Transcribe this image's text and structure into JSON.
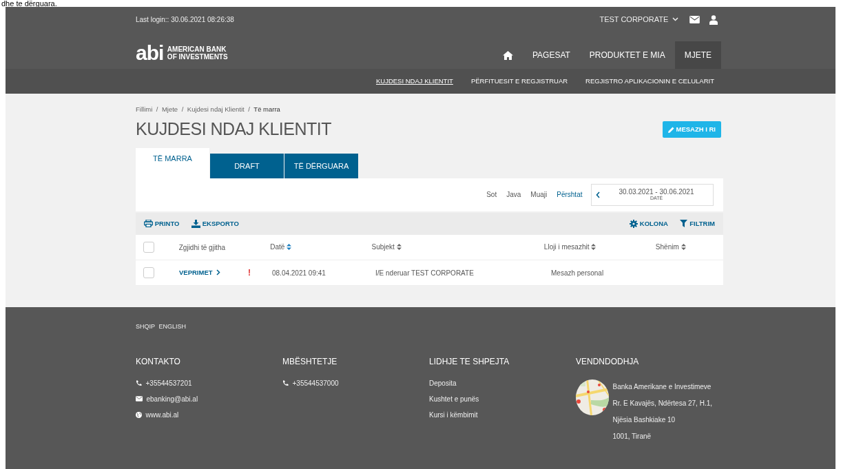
{
  "doc_fragment": "dhe te dërguara.",
  "top_bar": {
    "last_login": "Last login:: 30.06.2021 08:26:38",
    "company": "TEST CORPORATE"
  },
  "brand": {
    "logo": "abi",
    "name_line1": "AMERICAN BANK",
    "name_line2": "OF INVESTMENTS"
  },
  "main_nav": [
    {
      "kind": "home",
      "selected": false
    },
    {
      "kind": "text",
      "label": "PAGESAT",
      "selected": false
    },
    {
      "kind": "text",
      "label": "PRODUKTET E MIA",
      "selected": false
    },
    {
      "kind": "text",
      "label": "MJETE",
      "selected": true
    }
  ],
  "sub_nav": [
    {
      "label": "KUJDESI NDAJ KLIENTIT",
      "selected": true
    },
    {
      "label": "PËRFITUESIT E REGJISTRUAR",
      "selected": false
    },
    {
      "label": "REGJISTRO APLIKACIONIN E CELULARIT",
      "selected": false
    }
  ],
  "breadcrumb": [
    "Fillimi",
    "/",
    "Mjete",
    "/",
    "Kujdesi ndaj Klientit",
    "/",
    "Të marra"
  ],
  "page_title": "KUJDESI NDAJ KLIENTIT",
  "new_message_button": "MESAZH I RI",
  "tabs": [
    {
      "label": "TË MARRA",
      "selected": true
    },
    {
      "label": "DRAFT",
      "selected": false
    },
    {
      "label": "TË DËRGUARA",
      "selected": false
    }
  ],
  "period_filters": [
    {
      "label": "Sot",
      "selected": false
    },
    {
      "label": "Java",
      "selected": false
    },
    {
      "label": "Muaji",
      "selected": false
    },
    {
      "label": "Përshtat",
      "selected": true
    }
  ],
  "date_range": {
    "value": "30.03.2021 - 30.06.2021",
    "caption": "DATË"
  },
  "toolbar_left": [
    {
      "kind": "print",
      "label": "PRINTO"
    },
    {
      "kind": "download",
      "label": "EKSPORTO"
    }
  ],
  "toolbar_right": [
    {
      "kind": "gear",
      "label": "KOLONA"
    },
    {
      "kind": "filter",
      "label": "FILTRIM"
    }
  ],
  "table": {
    "select_all": {
      "label": "Zgjidhi të gjitha",
      "checked": false
    },
    "columns": [
      {
        "label": "Datë",
        "sorted": true
      },
      {
        "label": "Subjekt",
        "sorted": false
      },
      {
        "label": "Lloji i mesazhit",
        "sorted": false
      },
      {
        "label": "Shënim",
        "sorted": false
      }
    ],
    "rows": [
      {
        "checked": false,
        "action": "VEPRIMET",
        "flag": "!",
        "date": "08.04.2021 09:41",
        "subject": "I/E nderuar TEST CORPORATE",
        "type": "Mesazh personal"
      }
    ]
  },
  "footer": {
    "languages": [
      "SHQIP",
      "ENGLISH"
    ],
    "columns": [
      {
        "title": "KONTAKTO",
        "items": [
          {
            "kind": "phone",
            "text": "+35544537201"
          },
          {
            "kind": "mail",
            "text": "ebanking@abi.al"
          },
          {
            "kind": "globe",
            "text": "www.abi.al"
          }
        ]
      },
      {
        "title": "MBËSHTETJE",
        "items": [
          {
            "kind": "phone",
            "text": "+35544537000"
          }
        ]
      },
      {
        "title": "LIDHJE TE SHPEJTA",
        "items": [
          {
            "kind": "link",
            "text": "Deposita"
          },
          {
            "kind": "link",
            "text": "Kushtet e punës"
          },
          {
            "kind": "link",
            "text": "Kursi i këmbimit"
          }
        ]
      },
      {
        "title": "VENDNDODHJA",
        "items": [
          {
            "text": "Banka Amerikane e Investimeve"
          },
          {
            "text": "Rr. E Kavajës, Ndërtesa 27, H.1,"
          },
          {
            "text": "Njësia Bashkiake 10"
          },
          {
            "text": "1001, Tiranë"
          }
        ]
      }
    ]
  }
}
